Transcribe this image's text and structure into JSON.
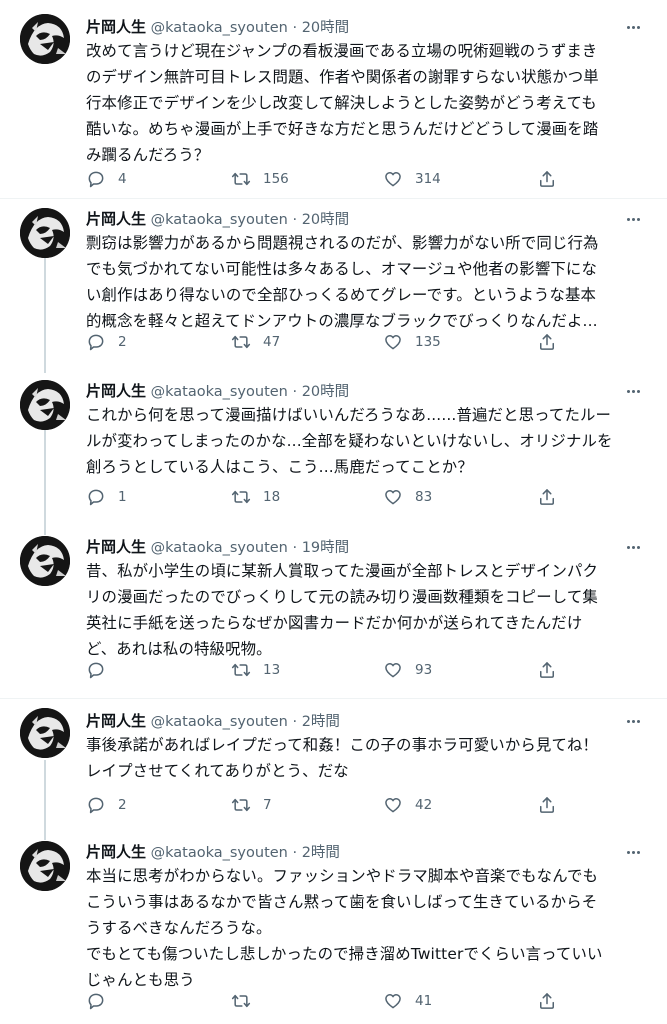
{
  "tweets": [
    {
      "name": "片岡人生",
      "handle": "@kataoka_syouten",
      "time": "20時間",
      "text": "改めて言うけど現在ジャンプの看板漫画である立場の呪術廻戦のうずまき\nのデザイン無許可目トレス問題、作者や関係者の謝罪すらない状態かつ単\n行本修正でデザインを少し改変して解決しようとした姿勢がどう考えても\n酷いな。めちゃ漫画が上手で好きな方だと思うんだけどどうして漫画を踏\nみ躙るんだろう？",
      "replies": "4",
      "retweets": "156",
      "likes": "314"
    },
    {
      "name": "片岡人生",
      "handle": "@kataoka_syouten",
      "time": "20時間",
      "text": "剽窃は影響力があるから問題視されるのだが、影響力がない所で同じ行為\nでも気づかれてない可能性は多々あるし、オマージュや他者の影響下にな\nい創作はあり得ないので全部ひっくるめてグレーです。というような基本\n的概念を軽々と超えてドンアウトの濃厚なブラックでびっくりなんだよ...",
      "replies": "2",
      "retweets": "47",
      "likes": "135"
    },
    {
      "name": "片岡人生",
      "handle": "@kataoka_syouten",
      "time": "20時間",
      "text": "これから何を思って漫画描けばいいんだろうなあ......普遍だと思ってたルー\nルが変わってしまったのかな...全部を疑わないといけないし、オリジナルを\n創ろうとしている人はこう、こう...馬鹿だってことか？",
      "replies": "1",
      "retweets": "18",
      "likes": "83"
    },
    {
      "name": "片岡人生",
      "handle": "@kataoka_syouten",
      "time": "19時間",
      "text": "昔、私が小学生の頃に某新人賞取ってた漫画が全部トレスとデザインパク\nリの漫画だったのでびっくりして元の読み切り漫画数種類をコピーして集\n英社に手紙を送ったらなぜか図書カードだか何かが送られてきたんだけ\nど、あれは私の特級呪物。",
      "replies": "",
      "retweets": "13",
      "likes": "93"
    },
    {
      "name": "片岡人生",
      "handle": "@kataoka_syouten",
      "time": "2時間",
      "text": "事後承諾があればレイプだって和姦！この子の事ホラ可愛いから見てね！\nレイプさせてくれてありがとう、だな",
      "replies": "2",
      "retweets": "7",
      "likes": "42"
    },
    {
      "name": "片岡人生",
      "handle": "@kataoka_syouten",
      "time": "2時間",
      "text": "本当に思考がわからない。ファッションやドラマ脚本や音楽でもなんでも\nこういう事はあるなかで皆さん黙って歯を食いしばって生きているからそ\nうするべきなんだろうな。\nでもとても傷ついたし悲しかったので掃き溜めTwitterでくらい言っていい\nじゃんとも思う",
      "replies": "",
      "retweets": "",
      "likes": "41"
    }
  ],
  "colors": {
    "text": "#0f1419",
    "muted": "#536471",
    "separator": "#eff3f4",
    "thread_line": "#cfd9de"
  },
  "icons": {
    "reply": "reply-icon",
    "retweet": "retweet-icon",
    "like": "heart-icon",
    "share": "share-icon",
    "more": "more-icon"
  }
}
